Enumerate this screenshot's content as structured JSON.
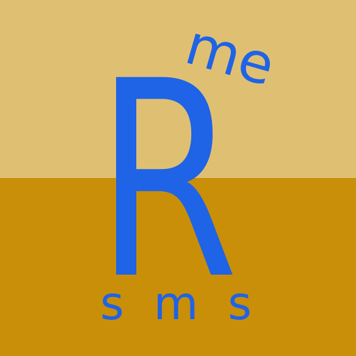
{
  "logo": {
    "main_letter": "R",
    "superscript": "me",
    "subtitle": "s m s"
  },
  "colors": {
    "top_background": "#DFC073",
    "bottom_background": "#C98F08",
    "letter_color": "#1F63E6"
  }
}
